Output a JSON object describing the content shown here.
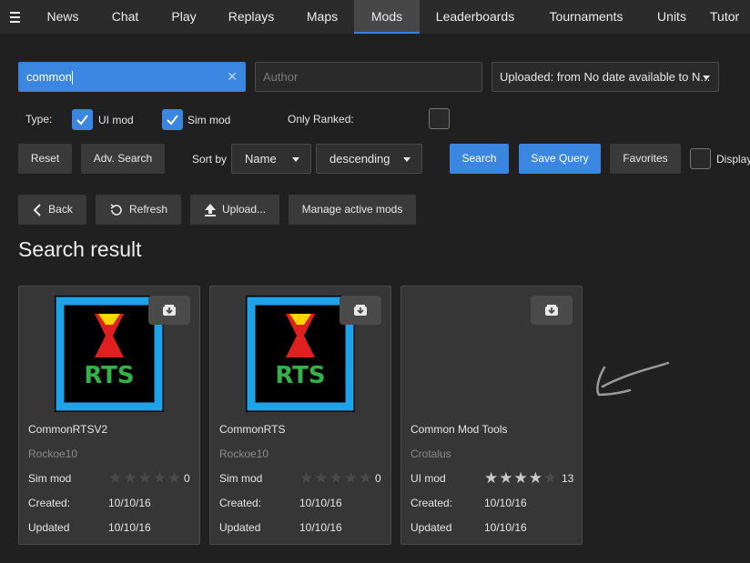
{
  "nav": {
    "tabs": [
      "News",
      "Chat",
      "Play",
      "Replays",
      "Maps",
      "Mods",
      "Leaderboards",
      "Tournaments",
      "Units",
      "Tutor"
    ],
    "active_tab": "Mods"
  },
  "search": {
    "name_value": "common",
    "author_placeholder": "Author",
    "date_filter": "Uploaded: from No date available to N..."
  },
  "filters": {
    "type_label": "Type:",
    "ui_mod_label": "UI mod",
    "ui_mod_checked": true,
    "sim_mod_label": "Sim mod",
    "sim_mod_checked": true,
    "only_ranked_label": "Only Ranked:",
    "only_ranked_checked": false
  },
  "toolbar": {
    "reset": "Reset",
    "adv_search": "Adv. Search",
    "sort_by_label": "Sort by",
    "sort_field": "Name",
    "sort_order": "descending",
    "search": "Search",
    "save_query": "Save Query",
    "favorites": "Favorites",
    "display_label": "Display"
  },
  "actions": {
    "back": "Back",
    "refresh": "Refresh",
    "upload": "Upload...",
    "manage": "Manage active mods"
  },
  "results_title": "Search result",
  "labels": {
    "created": "Created:",
    "updated": "Updated"
  },
  "mods": [
    {
      "title": "CommonRTSV2",
      "author": "Rockoe10",
      "type": "Sim mod",
      "rating": 0,
      "rating_count": "0",
      "created": "10/10/16",
      "updated": "10/10/16",
      "thumbnail_text": "RTS",
      "has_thumbnail": true
    },
    {
      "title": "CommonRTS",
      "author": "Rockoe10",
      "type": "Sim mod",
      "rating": 0,
      "rating_count": "0",
      "created": "10/10/16",
      "updated": "10/10/16",
      "thumbnail_text": "RTS",
      "has_thumbnail": true
    },
    {
      "title": "Common Mod Tools",
      "author": "Crotalus",
      "type": "UI mod",
      "rating": 4,
      "rating_count": "13",
      "created": "10/10/16",
      "updated": "10/10/16",
      "has_thumbnail": false
    }
  ],
  "colors": {
    "accent": "#3b86e0",
    "thumb_frame": "#1fa3e8",
    "rts_text": "#33b14a",
    "hourglass": "#e02020",
    "hourglass_top": "#ffd700"
  }
}
